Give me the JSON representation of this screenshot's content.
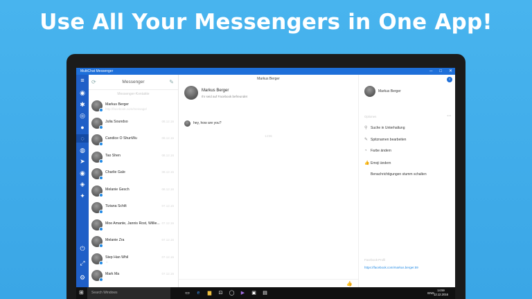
{
  "headline": "Use All Your Messengers in One App!",
  "window": {
    "title": "MultiChat Messenger",
    "minimize": "─",
    "maximize": "□",
    "close": "✕"
  },
  "rail_icons": [
    {
      "name": "whatsapp-icon",
      "glyph": "◉"
    },
    {
      "name": "settings-icon",
      "glyph": "✱"
    },
    {
      "name": "instagram-icon",
      "glyph": "◎"
    },
    {
      "name": "reddit-icon",
      "glyph": "●"
    },
    {
      "name": "messenger-icon",
      "glyph": "◌"
    },
    {
      "name": "skype-icon",
      "glyph": "◍"
    },
    {
      "name": "telegram-icon",
      "glyph": "➤"
    },
    {
      "name": "location-icon",
      "glyph": "◉"
    },
    {
      "name": "viber-icon",
      "glyph": "◈"
    },
    {
      "name": "twitter-icon",
      "glyph": "✦"
    }
  ],
  "rail_bottom_icons": [
    {
      "name": "power-icon",
      "glyph": "⏻"
    },
    {
      "name": "expand-icon",
      "glyph": "⤢"
    },
    {
      "name": "gear-icon",
      "glyph": "⚙"
    }
  ],
  "list": {
    "title": "Messenger",
    "subtitle": "Messenger-Kontakte",
    "contacts": [
      {
        "name": "Markus Berger",
        "preview": "http://facebook.com/message/",
        "time": ""
      },
      {
        "name": "Julia Soundso",
        "preview": "",
        "time": "08.12.16"
      },
      {
        "name": "Candice O ShunWu",
        "preview": "",
        "time": "08.12.16"
      },
      {
        "name": "Tao Shen",
        "preview": "",
        "time": "08.12.16"
      },
      {
        "name": "Charlie Gale",
        "preview": "",
        "time": "08.12.16"
      },
      {
        "name": "Melanie Gesch",
        "preview": "",
        "time": "08.12.16"
      },
      {
        "name": "Tiziana Schilt",
        "preview": "",
        "time": "07.12.16"
      },
      {
        "name": "Moe Amante, Jannis Rost, Willie...",
        "preview": "",
        "time": "07.12.16"
      },
      {
        "name": "Melanie Zra",
        "preview": "",
        "time": "07.12.16"
      },
      {
        "name": "Step Han Whil",
        "preview": "☺",
        "time": "07.12.16"
      },
      {
        "name": "Mark Ma",
        "preview": "",
        "time": "07.12.16"
      }
    ]
  },
  "chat": {
    "header": "Markus Berger",
    "contact_name": "Markus Berger",
    "contact_sub": "Ihr seid auf Facebook befreundet",
    "message": "hey, how are you?",
    "time": "14:55"
  },
  "info": {
    "name": "Markus Berger",
    "section_label": "Optionen",
    "options": [
      {
        "icon": "search-icon",
        "glyph": "⚲",
        "label": "Suche in Unterhaltung",
        "blue": false
      },
      {
        "icon": "edit-icon",
        "glyph": "✎",
        "label": "Spitznamen bearbeiten",
        "blue": false
      },
      {
        "icon": "palette-icon",
        "glyph": "◔",
        "label": "Farbe ändern",
        "blue": false
      },
      {
        "icon": "thumbs-up-icon",
        "glyph": "👍",
        "label": "Emoji ändern",
        "blue": true
      },
      {
        "icon": "bell-icon",
        "glyph": "",
        "label": "Benachrichtigungen stumm schalten",
        "blue": false
      }
    ],
    "profile_label": "Facebook-Profil",
    "profile_link": "https://facebook.com/markus.berger.59"
  },
  "taskbar": {
    "search_placeholder": "Search Windows",
    "tray_lang": "ENG",
    "time": "14:59",
    "date": "12.12.2016"
  }
}
